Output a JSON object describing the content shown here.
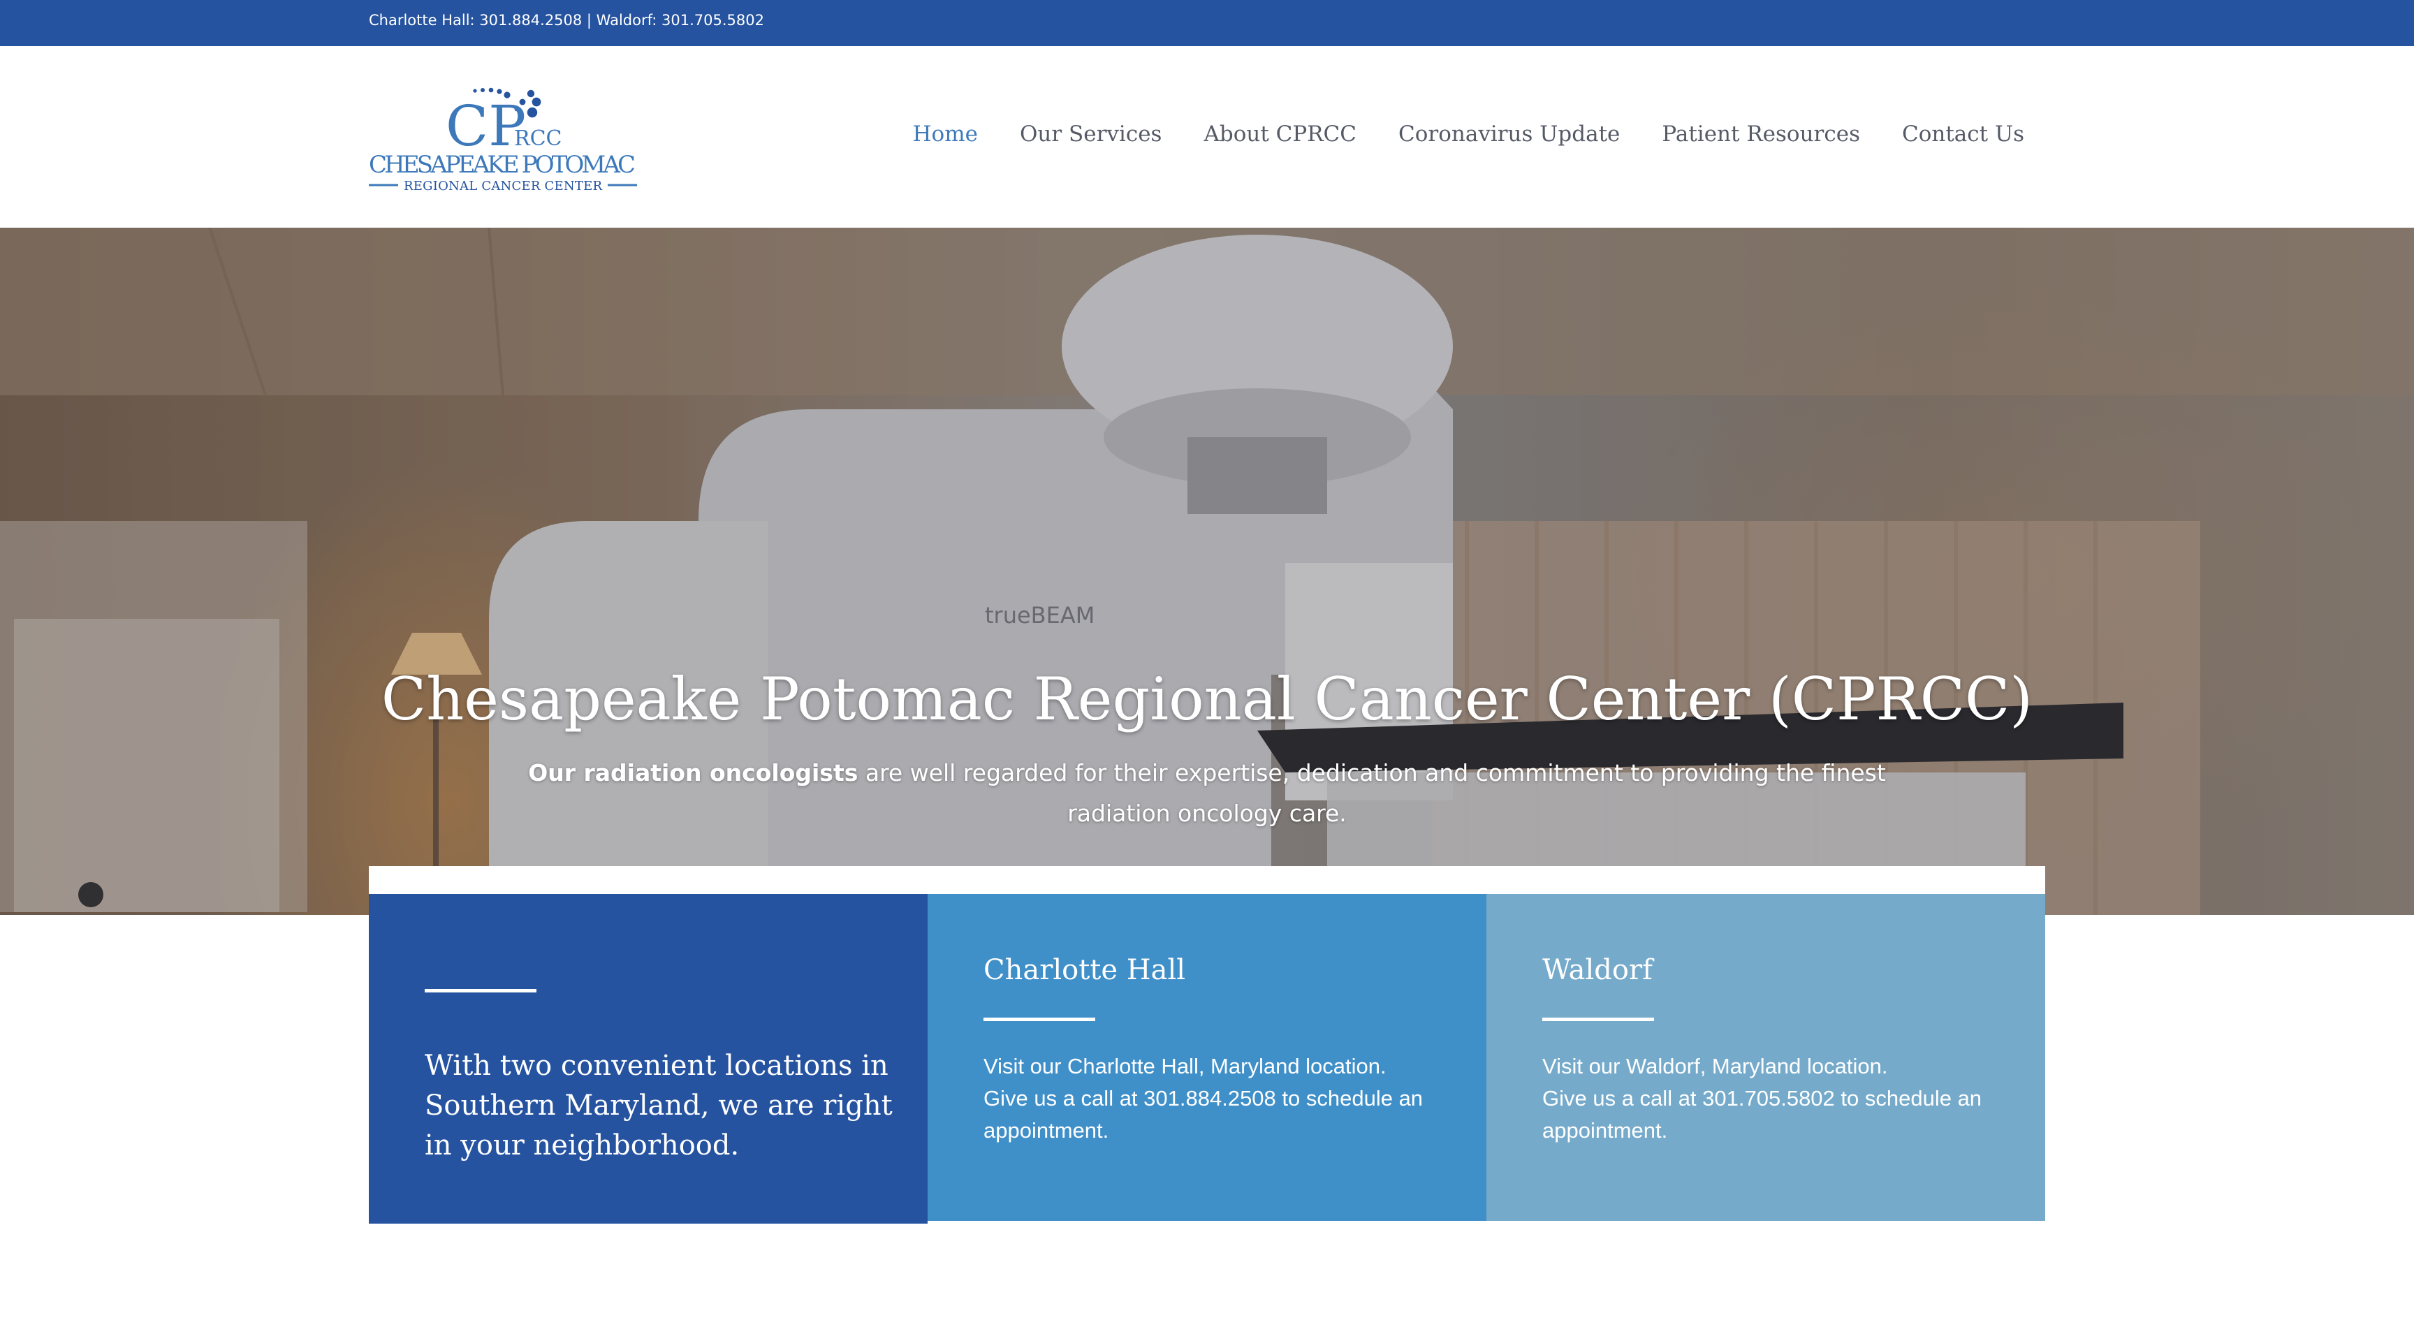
{
  "topbar": {
    "phones": "Charlotte Hall: 301.884.2508 | Waldorf: 301.705.5802"
  },
  "logo": {
    "monogram": "CP",
    "monogram_sub": "RCC",
    "name_line1": "CHESAPEAKE POTOMAC",
    "name_line2": "REGIONAL CANCER CENTER"
  },
  "nav": {
    "items": [
      {
        "label": "Home",
        "active": true
      },
      {
        "label": "Our Services"
      },
      {
        "label": "About CPRCC"
      },
      {
        "label": "Coronavirus Update"
      },
      {
        "label": "Patient Resources"
      },
      {
        "label": "Contact Us"
      }
    ]
  },
  "hero": {
    "machine_label": "trueBEAM",
    "title": "Chesapeake Potomac Regional Cancer Center (CPRCC)",
    "subtitle_bold": "Our radiation oncologists",
    "subtitle_rest": " are well regarded for their expertise, dedication and commitment to providing the finest radiation oncology care."
  },
  "locations": {
    "intro": "With two convenient locations in Southern Maryland, we are right in your neighborhood.",
    "cards": [
      {
        "title": "Charlotte Hall",
        "line1": "Visit our Charlotte Hall, Maryland location.",
        "line2": "Give us a call at 301.884.2508 to schedule an appointment."
      },
      {
        "title": "Waldorf",
        "line1": "Visit our Waldorf, Maryland location.",
        "line2": "Give us a call at 301.705.5802 to schedule an appointment."
      }
    ]
  },
  "colors": {
    "brand_blue": "#2553a0",
    "mid_blue": "#3f8fc9",
    "light_blue": "#75aacb",
    "nav_active": "#3d79ba",
    "nav_text": "#555a66"
  }
}
